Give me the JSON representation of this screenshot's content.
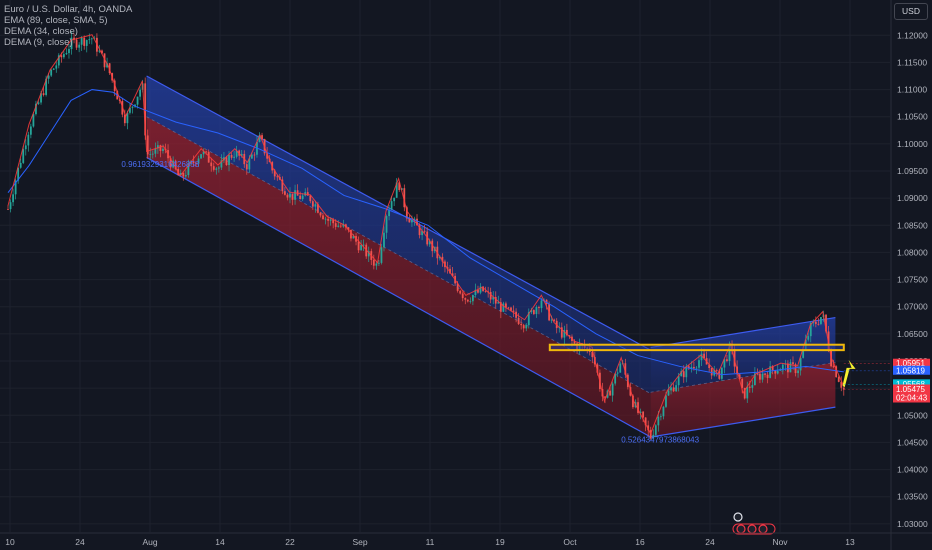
{
  "legend": {
    "symbol": "Euro / U.S. Dollar, 4h, OANDA",
    "ema": "EMA (89, close, SMA, 5)",
    "dema1": "DEMA (34, close)",
    "dema2": "DEMA (9, close)"
  },
  "currency_button": "USD",
  "colors": {
    "background": "#131722",
    "grid": "#1e222d",
    "channel_line": "#3d5bf0",
    "upper_fill": "#2440a8",
    "lower_fill": "#8a1f2e",
    "candle_up": "#26a69a",
    "candle_down": "#ef5350",
    "ema": "#2962ff",
    "dema_fast": "#ff3b3b",
    "box": "#f0b90b",
    "arrow": "#f7f12f",
    "price_red": "#f23645",
    "price_blue": "#2962ff",
    "price_cyan": "#00bcd4"
  },
  "chart_data": {
    "type": "candlestick",
    "ylim": [
      1.0285,
      1.1265
    ],
    "y_ticks": [
      "1.12000",
      "1.11500",
      "1.11000",
      "1.10500",
      "1.10000",
      "1.09500",
      "1.09000",
      "1.08500",
      "1.08000",
      "1.07500",
      "1.07000",
      "1.06500",
      "1.06000",
      "1.05500",
      "1.05000",
      "1.04500",
      "1.04000",
      "1.03500",
      "1.03000"
    ],
    "x_ticks": [
      "10",
      "24",
      "Aug",
      "14",
      "22",
      "Sep",
      "11",
      "19",
      "Oct",
      "16",
      "24",
      "Nov",
      "13"
    ],
    "price_path": [
      [
        0,
        1.088
      ],
      [
        0.5,
        1.103
      ],
      [
        1,
        1.113
      ],
      [
        1.5,
        1.1185
      ],
      [
        2,
        1.1195
      ],
      [
        2.4,
        1.1135
      ],
      [
        2.8,
        1.1045
      ],
      [
        3.2,
        1.111
      ],
      [
        3.3,
        1.098
      ],
      [
        3.7,
        1.099
      ],
      [
        4.1,
        1.0935
      ],
      [
        4.6,
        1.0985
      ],
      [
        5.0,
        1.0955
      ],
      [
        5.4,
        1.0985
      ],
      [
        5.7,
        1.096
      ],
      [
        6.0,
        1.101
      ],
      [
        6.3,
        1.095
      ],
      [
        6.7,
        1.0905
      ],
      [
        7.2,
        1.09
      ],
      [
        7.6,
        1.086
      ],
      [
        8.0,
        1.0845
      ],
      [
        8.4,
        1.081
      ],
      [
        8.8,
        1.0775
      ],
      [
        9.0,
        1.087
      ],
      [
        9.3,
        1.093
      ],
      [
        9.5,
        1.087
      ],
      [
        10.0,
        1.082
      ],
      [
        10.5,
        1.076
      ],
      [
        10.9,
        1.0715
      ],
      [
        11.3,
        1.073
      ],
      [
        11.8,
        1.0695
      ],
      [
        12.3,
        1.067
      ],
      [
        12.7,
        1.0715
      ],
      [
        13.0,
        1.0665
      ],
      [
        13.5,
        1.063
      ],
      [
        13.9,
        1.062
      ],
      [
        14.2,
        1.052
      ],
      [
        14.6,
        1.06
      ],
      [
        14.9,
        1.052
      ],
      [
        15.3,
        1.046
      ],
      [
        15.7,
        1.054
      ],
      [
        16.1,
        1.058
      ],
      [
        16.5,
        1.0605
      ],
      [
        16.9,
        1.057
      ],
      [
        17.2,
        1.0625
      ],
      [
        17.5,
        1.0535
      ],
      [
        17.8,
        1.057
      ],
      [
        18.1,
        1.058
      ],
      [
        18.4,
        1.059
      ],
      [
        18.8,
        1.0585
      ],
      [
        19.1,
        1.066
      ],
      [
        19.4,
        1.0685
      ],
      [
        19.6,
        1.06
      ],
      [
        19.9,
        1.0547
      ]
    ],
    "ema_path": [
      [
        0,
        1.091
      ],
      [
        0.5,
        1.096
      ],
      [
        1,
        1.102
      ],
      [
        1.5,
        1.108
      ],
      [
        2,
        1.11
      ],
      [
        2.5,
        1.1095
      ],
      [
        3,
        1.107
      ],
      [
        4,
        1.104
      ],
      [
        5,
        1.102
      ],
      [
        6,
        1.099
      ],
      [
        7,
        1.0955
      ],
      [
        8,
        1.0905
      ],
      [
        9,
        1.088
      ],
      [
        10,
        1.085
      ],
      [
        11,
        1.079
      ],
      [
        12,
        1.0745
      ],
      [
        13,
        1.07
      ],
      [
        14,
        1.065
      ],
      [
        15,
        1.061
      ],
      [
        16,
        1.059
      ],
      [
        17,
        1.0575
      ],
      [
        18,
        1.058
      ],
      [
        19,
        1.059
      ],
      [
        19.9,
        1.058
      ]
    ],
    "channel1": {
      "upper": [
        [
          3.3,
          1.1125
        ],
        [
          15.3,
          1.062
        ]
      ],
      "lower": [
        [
          3.3,
          1.0975
        ],
        [
          15.3,
          1.046
        ]
      ]
    },
    "channel2": {
      "upper": [
        [
          15.3,
          1.0625
        ],
        [
          19.7,
          1.068
        ]
      ],
      "lower": [
        [
          15.3,
          1.046
        ],
        [
          19.7,
          1.0515
        ]
      ]
    },
    "box": {
      "x0": 12.9,
      "x1": 19.9,
      "y_top": 1.063,
      "y_bottom": 1.062
    },
    "arrow": {
      "x": 19.8,
      "from": 1.0555,
      "to": 1.0602
    },
    "annotations": [
      {
        "text": "0.9619329316426858",
        "x": 2.7,
        "y": 1.0957
      },
      {
        "text": "0.5264347973868043",
        "x": 14.6,
        "y": 1.045
      }
    ],
    "price_labels": [
      {
        "value": "1.05951",
        "y": 1.0595,
        "color": "#f23645"
      },
      {
        "value": "1.05819",
        "y": 1.0582,
        "color": "#2962ff"
      },
      {
        "value": "1.05568",
        "y": 1.0557,
        "color": "#00bcd4"
      },
      {
        "value": "1.05475",
        "y": 1.05475,
        "color": "#f23645",
        "sub": "02:04:43"
      }
    ]
  }
}
